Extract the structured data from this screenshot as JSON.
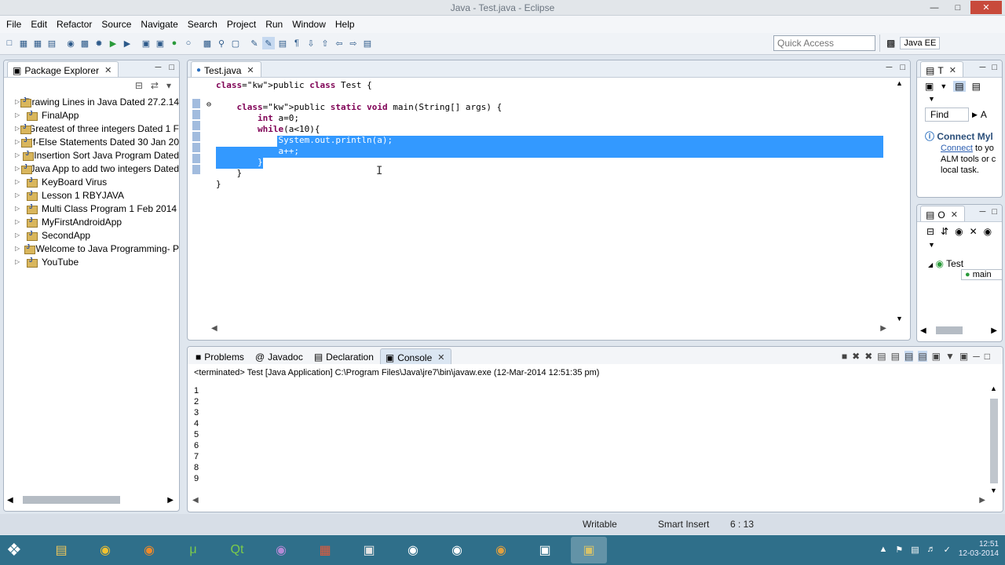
{
  "window": {
    "title": "Java - Test.java - Eclipse"
  },
  "menu": [
    "File",
    "Edit",
    "Refactor",
    "Source",
    "Navigate",
    "Search",
    "Project",
    "Run",
    "Window",
    "Help"
  ],
  "quick_access": {
    "placeholder": "Quick Access"
  },
  "perspective": {
    "label": "Java EE"
  },
  "package_explorer": {
    "tab_label": "Package Explorer",
    "projects": [
      "Drawing Lines in Java Dated 27.2.14",
      "FinalApp",
      "Greatest of three integers Dated 1 F",
      "If-Else Statements Dated 30 Jan 20",
      "Insertion Sort Java Program Dated",
      "Java App to add two integers Dated",
      "KeyBoard Virus",
      "Lesson 1 RBYJAVA",
      "Multi Class Program 1 Feb 2014",
      "MyFirstAndroidApp",
      "SecondApp",
      "Welcome to Java Programming- P",
      "YouTube"
    ]
  },
  "editor": {
    "tab_label": "Test.java",
    "lines": [
      "public class Test {",
      "",
      "    public static void main(String[] args) {",
      "        int a=0;",
      "        while(a<10){",
      "            System.out.println(a);",
      "            a++;",
      "        }",
      "    }",
      "}"
    ]
  },
  "task_list": {
    "tab_label": "T",
    "find_label": "Find",
    "all_label": "A",
    "connect_title": "Connect Myl",
    "connect_link": "Connect",
    "connect_text_1": "to yo",
    "connect_text_2": "ALM tools or c",
    "connect_text_3": "local task."
  },
  "outline": {
    "tab_label": "O",
    "class_name": "Test",
    "method_name": "main"
  },
  "console": {
    "tabs": [
      "Problems",
      "Javadoc",
      "Declaration",
      "Console"
    ],
    "terminated_text": "<terminated> Test [Java Application] C:\\Program Files\\Java\\jre7\\bin\\javaw.exe (12-Mar-2014 12:51:35 pm)",
    "output": [
      "1",
      "2",
      "3",
      "4",
      "5",
      "6",
      "7",
      "8",
      "9"
    ]
  },
  "statusbar": {
    "writable": "Writable",
    "insert_mode": "Smart Insert",
    "position": "6 : 13"
  },
  "taskbar": {
    "time": "12:51",
    "date": "12-03-2014"
  }
}
